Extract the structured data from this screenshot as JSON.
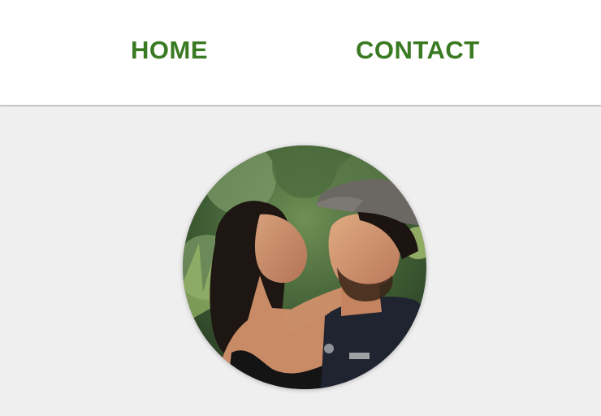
{
  "nav": {
    "items": [
      {
        "label": "HOME"
      },
      {
        "label": "CONTACT"
      }
    ]
  },
  "colors": {
    "nav_text": "#3a7a22",
    "header_bg": "#ffffff",
    "page_bg": "#efefef"
  },
  "profile": {
    "image": "profile-photo"
  }
}
